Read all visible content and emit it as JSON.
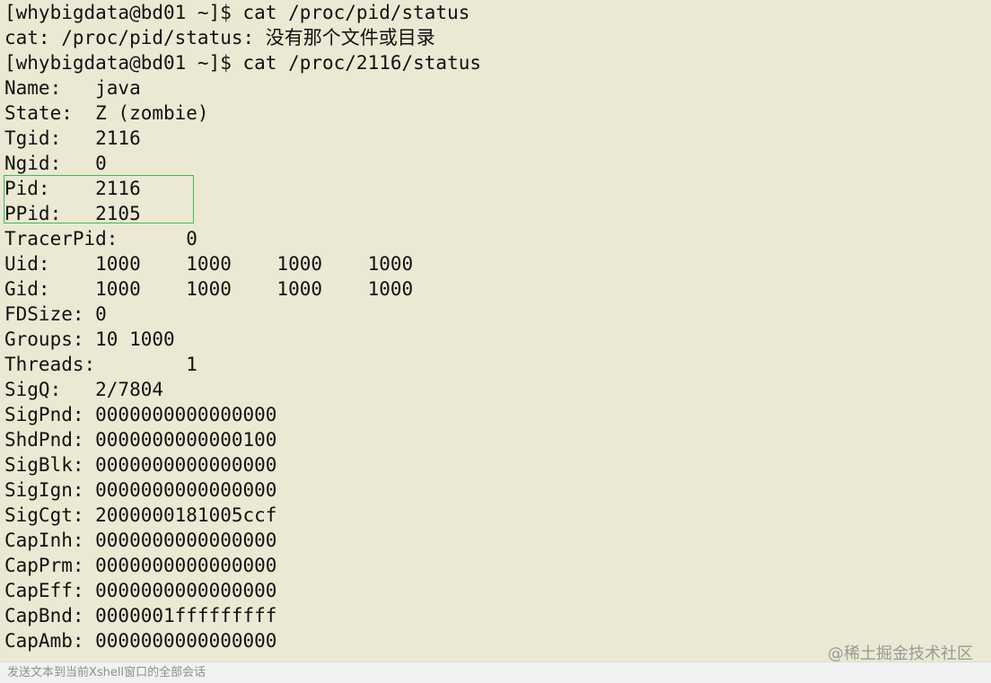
{
  "terminal": {
    "lines": [
      "[whybigdata@bd01 ~]$ cat /proc/pid/status",
      "cat: /proc/pid/status: 没有那个文件或目录",
      "[whybigdata@bd01 ~]$ cat /proc/2116/status",
      "Name:   java",
      "State:  Z (zombie)",
      "Tgid:   2116",
      "Ngid:   0",
      "Pid:    2116",
      "PPid:   2105",
      "TracerPid:      0",
      "Uid:    1000    1000    1000    1000",
      "Gid:    1000    1000    1000    1000",
      "FDSize: 0",
      "Groups: 10 1000",
      "Threads:        1",
      "SigQ:   2/7804",
      "SigPnd: 0000000000000000",
      "ShdPnd: 0000000000000100",
      "SigBlk: 0000000000000000",
      "SigIgn: 0000000000000000",
      "SigCgt: 2000000181005ccf",
      "CapInh: 0000000000000000",
      "CapPrm: 0000000000000000",
      "CapEff: 0000000000000000",
      "CapBnd: 0000001fffffffff",
      "CapAmb: 0000000000000000"
    ]
  },
  "highlight": {
    "color": "#3dbb5a"
  },
  "watermark": {
    "text": "@稀土掘金技术社区"
  },
  "send_bar": {
    "placeholder": "发送文本到当前Xshell窗口的全部会话"
  }
}
